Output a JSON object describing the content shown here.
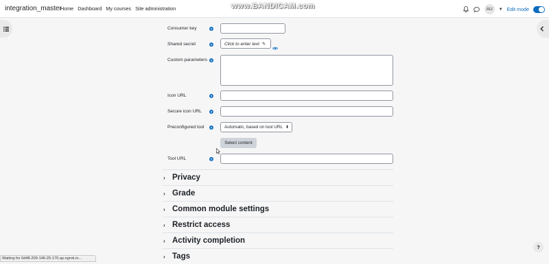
{
  "navbar": {
    "brand": "integration_master",
    "links": [
      "Home",
      "Dashboard",
      "My courses",
      "Site administration"
    ],
    "watermark": "www.BANDICAM.com",
    "avatar_initials": "AU",
    "edit_mode_label": "Edit mode",
    "edit_mode_on": true
  },
  "form": {
    "consumer_key": {
      "label": "Consumer key",
      "value": ""
    },
    "shared_secret": {
      "label": "Shared secret",
      "placeholder": "Click to enter text"
    },
    "custom_parameters": {
      "label": "Custom parameters",
      "value": ""
    },
    "icon_url": {
      "label": "Icon URL",
      "value": ""
    },
    "secure_icon_url": {
      "label": "Secure icon URL",
      "value": ""
    },
    "preconfigured_tool": {
      "label": "Preconfigured tool",
      "selected": "Automatic, based on tool URL"
    },
    "select_content_label": "Select content",
    "tool_url": {
      "label": "Tool URL",
      "value": ""
    }
  },
  "sections": [
    "Privacy",
    "Grade",
    "Common module settings",
    "Restrict access",
    "Activity completion",
    "Tags"
  ],
  "status_bar": "Waiting for 6d48-209-146-25-170.ap.ngrok.io...",
  "help_fab": "?",
  "colors": {
    "accent": "#0f6cbf"
  }
}
